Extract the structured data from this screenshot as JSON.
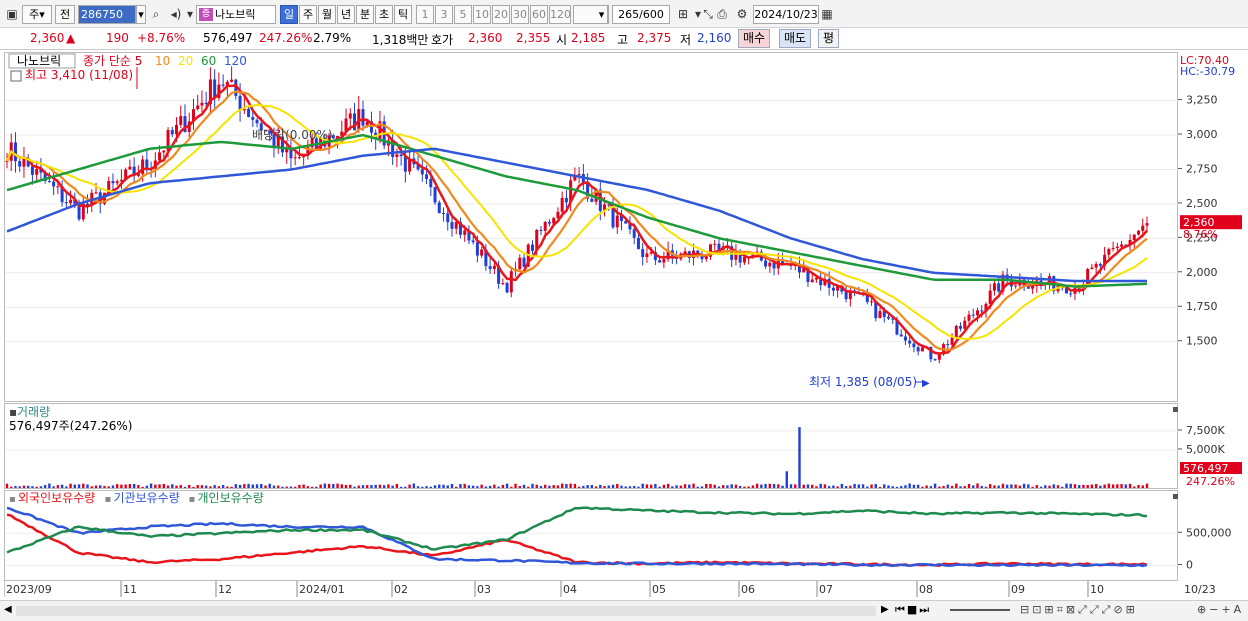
{
  "toolbar": {
    "market_label": "주",
    "prev_label": "전",
    "code": "286750",
    "name_badge": "증",
    "name": "나노브릭",
    "periods": [
      "일",
      "주",
      "월",
      "년",
      "분",
      "초",
      "틱"
    ],
    "active_period": "일",
    "intervals": [
      "1",
      "3",
      "5",
      "10",
      "20",
      "30",
      "60",
      "120"
    ],
    "count": "265",
    "count_max": "/600",
    "date": "2024/10/23"
  },
  "quote": {
    "price": "2,360",
    "arrow": "▲",
    "change": "190",
    "change_pct": "+8.76%",
    "volume": "576,497",
    "volume_ratio": "247.26%",
    "turnover_pct": "2.79%",
    "amount": "1,318백만",
    "hoga_label": "호가",
    "ask": "2,360",
    "bid": "2,355",
    "open_label": "시",
    "open": "2,185",
    "high_label": "고",
    "high": "2,375",
    "low_label": "저",
    "low": "2,160",
    "buy_label": "매수",
    "sell_label": "매도",
    "avg_label": "평"
  },
  "price_panel": {
    "name_tag": "나노브릭",
    "ma_title": "종가 단순",
    "ma_periods": [
      "5",
      "10",
      "20",
      "60",
      "120"
    ],
    "ma_colors": [
      "#e8151b",
      "#f08a1c",
      "#f5e400",
      "#1f9a3a",
      "#2f57d8"
    ],
    "max_note": "최고 3,410 (11/08)",
    "min_note": "최저 1,385 (08/05)",
    "div_note": "배당락(0.00%)",
    "lc": "LC:70.40",
    "hc": "HC:-30.79",
    "last_price_tag": "2,360",
    "last_pct_tag": "8.76%",
    "yticks": [
      "3,250",
      "3,000",
      "2,750",
      "2,500",
      "2,250",
      "2,000",
      "1,750",
      "1,500"
    ]
  },
  "volume_panel": {
    "title": "거래량",
    "value": "576,497주(247.26%)",
    "yticks": [
      "7,500K",
      "5,000K"
    ],
    "last_tag": "576,497",
    "last_pct": "247.26%"
  },
  "ownership_panel": {
    "series": [
      "외국인보유수량",
      "기관보유수량",
      "개인보유수량"
    ],
    "series_colors": [
      "#e8151b",
      "#2f57d8",
      "#1f8a50"
    ],
    "yticks": [
      "500,000",
      "0"
    ]
  },
  "xaxis": {
    "labels": [
      "2023/09",
      "11",
      "12",
      "2024/01",
      "02",
      "03",
      "04",
      "05",
      "06",
      "07",
      "08",
      "09",
      "10"
    ],
    "right_label": "10/23"
  },
  "chart_data": {
    "type": "line",
    "title": "나노브릭",
    "date_range": [
      "2023/09",
      "2024/10/23"
    ],
    "ylim": [
      1200,
      3450
    ],
    "close_series_name": "종가",
    "close_x": [
      "2023/09",
      "2023/10",
      "2023/11",
      "2023/11/08",
      "2023/12",
      "2024/01",
      "2024/02",
      "2024/03",
      "2024/03/08",
      "2024/04",
      "2024/05",
      "2024/06",
      "2024/07",
      "2024/08/05",
      "2024/09",
      "2024/10",
      "2024/10/23"
    ],
    "close_y": [
      2900,
      2450,
      2800,
      3410,
      2800,
      3150,
      2550,
      1900,
      2700,
      2100,
      2150,
      2050,
      1800,
      1385,
      1950,
      1900,
      2360
    ],
    "ma120_y": [
      2300,
      2500,
      2650,
      2700,
      2750,
      2850,
      2900,
      2800,
      2700,
      2600,
      2450,
      2250,
      2100,
      2000,
      1970,
      1940,
      1940
    ],
    "ma60_y": [
      2600,
      2750,
      2900,
      2950,
      2900,
      3000,
      2850,
      2700,
      2600,
      2400,
      2250,
      2150,
      2050,
      1950,
      1950,
      1900,
      1920
    ],
    "volume_peak_k": 8000,
    "ownership_ylim": [
      -100000,
      1000000
    ],
    "foreign_y": [
      800000,
      200000,
      50000,
      100000,
      200000,
      300000,
      150000,
      400000,
      50000,
      30000,
      50000,
      30000,
      20000,
      10000,
      30000,
      20000,
      20000
    ],
    "institution_y": [
      900000,
      500000,
      600000,
      650000,
      600000,
      600000,
      100000,
      80000,
      40000,
      30000,
      30000,
      20000,
      10000,
      10000,
      5000,
      5000,
      5000
    ],
    "individual_y": [
      200000,
      600000,
      450000,
      500000,
      550000,
      550000,
      250000,
      400000,
      900000,
      850000,
      820000,
      800000,
      850000,
      800000,
      820000,
      800000,
      780000
    ]
  }
}
